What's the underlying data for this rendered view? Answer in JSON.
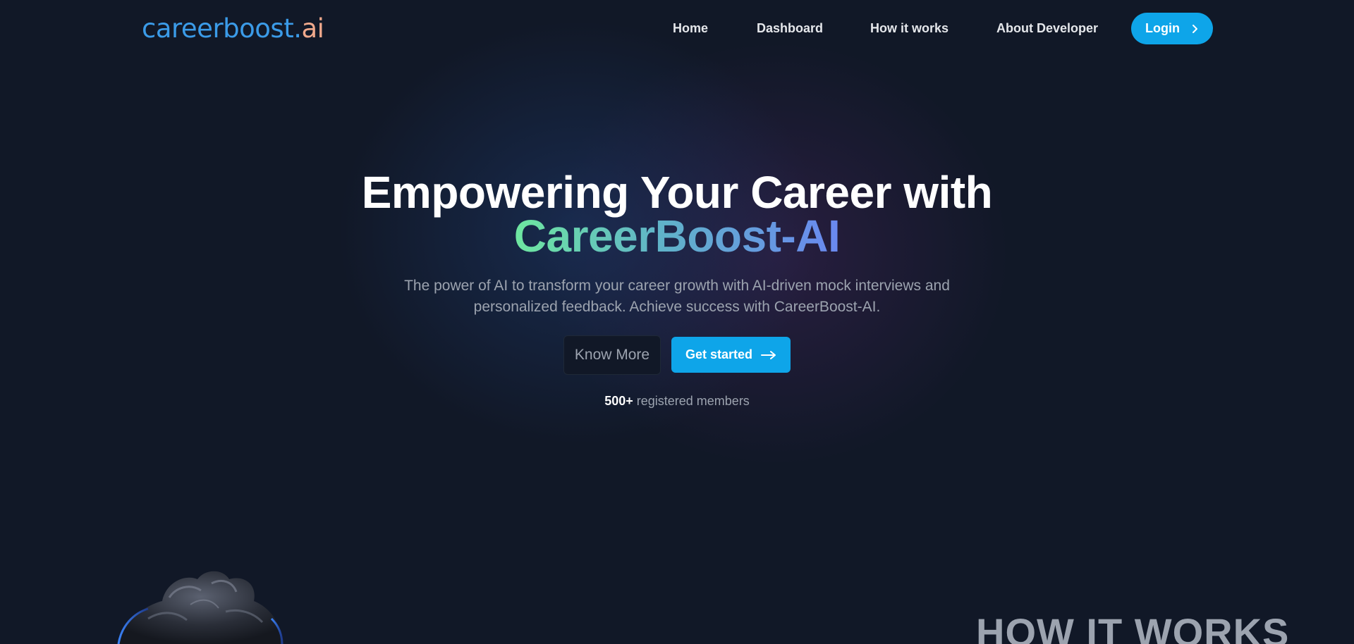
{
  "nav": {
    "logo": {
      "main": "careerboost",
      "dot": ".",
      "suffix": "ai"
    },
    "links": [
      "Home",
      "Dashboard",
      "How it works",
      "About Developer"
    ],
    "login_label": "Login"
  },
  "hero": {
    "title_line1": "Empowering Your Career with",
    "title_line2": "CareerBoost-AI",
    "subtitle": "The power of AI to transform your career growth with AI-driven mock interviews and personalized feedback. Achieve success with CareerBoost-AI.",
    "know_more_label": "Know More",
    "get_started_label": "Get started",
    "members_count": "500+",
    "members_label": "registered members"
  },
  "section": {
    "heading": "HOW IT WORKS"
  },
  "icons": {
    "login": "chevron-right-icon",
    "get_started": "arrow-right-icon"
  },
  "colors": {
    "background": "#111827",
    "accent": "#0ea5e9",
    "logo_blue": "#3b9be8",
    "logo_ai": "#f0a98c",
    "gradient_start": "#6ee7a0",
    "gradient_end": "#6a88f0",
    "muted_text": "#9ca3af"
  }
}
